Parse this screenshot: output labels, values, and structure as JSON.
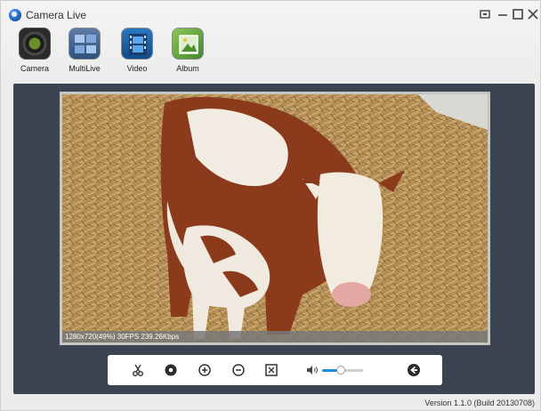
{
  "app": {
    "title": "Camera Live"
  },
  "toolbar": {
    "items": [
      {
        "label": "Camera",
        "icon": "camera-lens-icon"
      },
      {
        "label": "MultiLive",
        "icon": "multilive-grid-icon"
      },
      {
        "label": "Video",
        "icon": "film-strip-icon"
      },
      {
        "label": "Album",
        "icon": "album-icon"
      }
    ]
  },
  "video": {
    "status": "1280x720(49%)  30FPS 239.26Kbps"
  },
  "controls": {
    "volume_level": 0.45,
    "icons": [
      "scissors-icon",
      "record-icon",
      "zoom-in-icon",
      "zoom-out-icon",
      "fit-screen-icon",
      "speaker-icon",
      "back-icon"
    ]
  },
  "footer": {
    "version": "Version 1.1.0 (Build 20130708)"
  },
  "colors": {
    "accent": "#1c8fe0",
    "stage": "#3b4450"
  }
}
